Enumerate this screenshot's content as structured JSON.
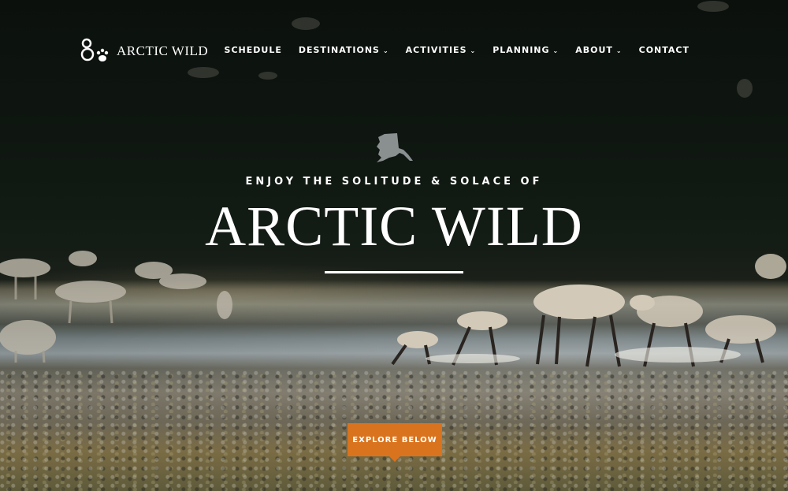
{
  "brand": {
    "name": "ARCTIC WILD",
    "logo_icon": "bear-paw-icon"
  },
  "nav": {
    "items": [
      {
        "label": "SCHEDULE",
        "dropdown": false
      },
      {
        "label": "DESTINATIONS",
        "dropdown": true
      },
      {
        "label": "ACTIVITIES",
        "dropdown": true
      },
      {
        "label": "PLANNING",
        "dropdown": true
      },
      {
        "label": "ABOUT",
        "dropdown": true
      },
      {
        "label": "CONTACT",
        "dropdown": false
      }
    ],
    "chevron": "⌄"
  },
  "hero": {
    "icon": "alaska-map-icon",
    "tagline": "ENJOY THE SOLITUDE & SOLACE OF",
    "headline": "ARCTIC WILD",
    "cta_label": "EXPLORE BELOW"
  },
  "colors": {
    "accent": "#d9731d",
    "text": "#ffffff"
  }
}
